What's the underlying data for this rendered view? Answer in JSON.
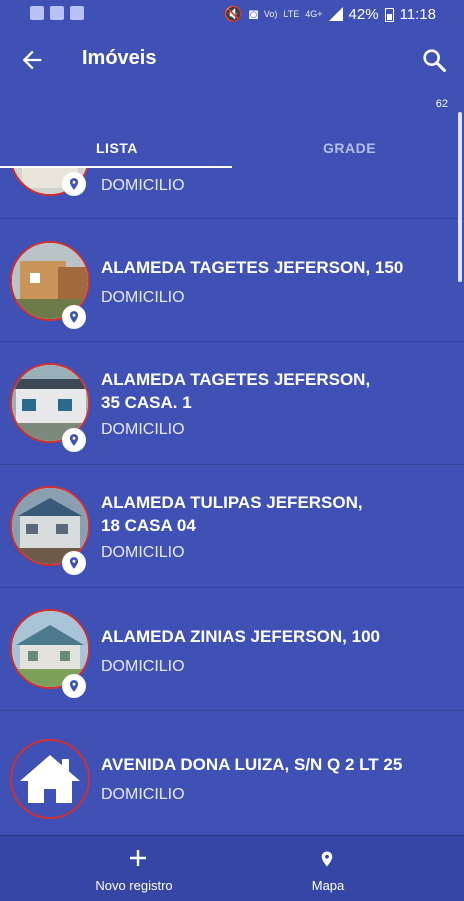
{
  "status": {
    "battery": "42%",
    "time": "11:18",
    "net1": "Vo)",
    "net2": "LTE",
    "net3": "4G+"
  },
  "header": {
    "title": "Imóveis",
    "count": "62"
  },
  "tabs": [
    "LISTA",
    "GRADE"
  ],
  "items": [
    {
      "address": "",
      "type": "DOMICILIO"
    },
    {
      "address": "ALAMEDA TAGETES JEFERSON, 150",
      "type": "DOMICILIO"
    },
    {
      "address": "ALAMEDA TAGETES JEFERSON,\n35 CASA. 1",
      "type": "DOMICILIO"
    },
    {
      "address": "ALAMEDA TULIPAS JEFERSON,\n18 CASA 04",
      "type": "DOMICILIO"
    },
    {
      "address": "ALAMEDA ZINIAS JEFERSON, 100",
      "type": "DOMICILIO"
    },
    {
      "address": "AVENIDA DONA LUIZA, S/N Q 2 LT 25",
      "type": "DOMICILIO"
    }
  ],
  "bottom_nav": {
    "new_label": "Novo registro",
    "map_label": "Mapa"
  }
}
